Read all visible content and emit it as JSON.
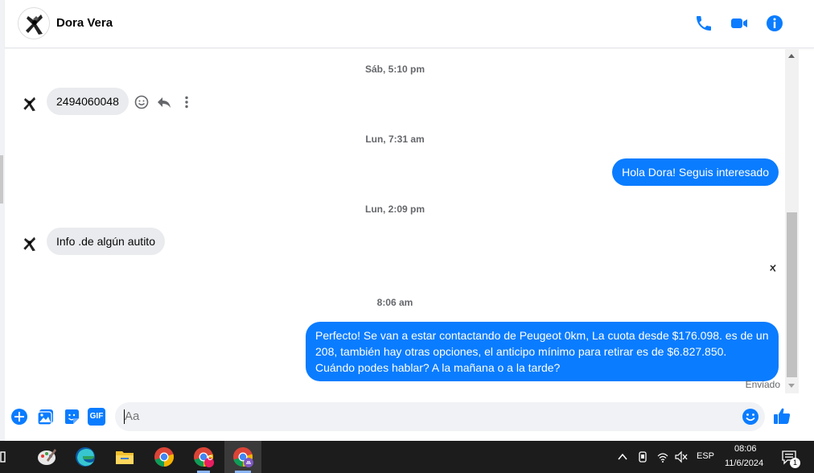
{
  "header": {
    "contact_name": "Dora Vera",
    "icons": [
      "phone-icon",
      "video-camera-icon",
      "info-icon"
    ],
    "accent_color": "#0a7cff"
  },
  "conversation": {
    "separators": [
      "Sáb, 5:10 pm",
      "Lun, 7:31 am",
      "Lun, 2:09 pm",
      "8:06 am"
    ],
    "messages": [
      {
        "from": "contact",
        "text": "2494060048"
      },
      {
        "from": "me",
        "text": "Hola Dora! Seguis interesado"
      },
      {
        "from": "contact",
        "text": "Info .de algún autito"
      },
      {
        "from": "me",
        "text": "Perfecto!  Se van a estar contactando de Peugeot 0km, La cuota desde $176.098. es de un 208, también hay otras opciones, el anticipo mínimo para retirar es de $6.827.850. Cuándo podes hablar? A la mañana o a la tarde?"
      }
    ],
    "status": "Enviado"
  },
  "composer": {
    "placeholder": "Aa",
    "icons": [
      "plus-icon",
      "image-icon",
      "sticker-icon",
      "gif-icon",
      "emoji-icon",
      "thumbs-up-icon"
    ],
    "gif_label": "GIF"
  },
  "taskbar": {
    "language": "ESP",
    "time": "08:06",
    "date": "11/6/2024",
    "notification_count": "1",
    "profile_badge": "C"
  }
}
